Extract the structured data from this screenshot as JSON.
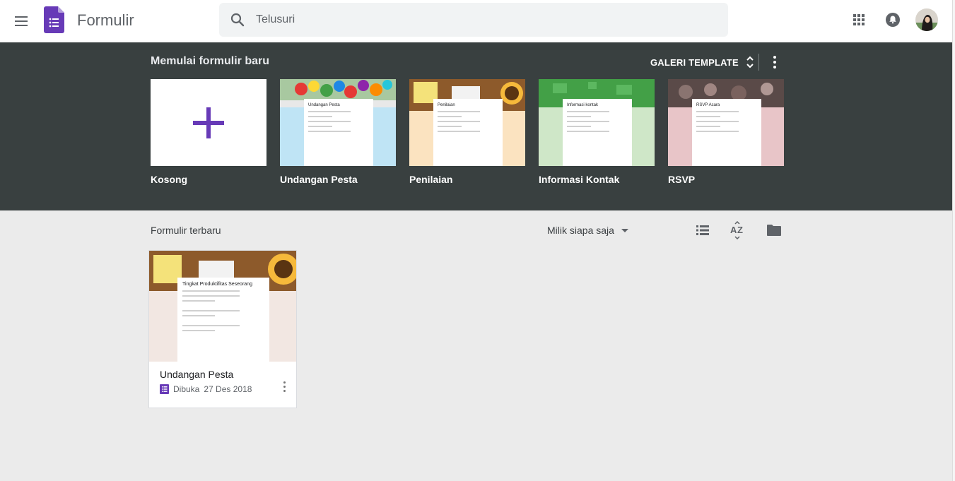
{
  "header": {
    "app_name": "Formulir",
    "search_placeholder": "Telusuri",
    "brand_color": "#673ab7"
  },
  "templates": {
    "section_title": "Memulai formulir baru",
    "gallery_label": "GALERI TEMPLATE",
    "items": [
      {
        "label": "Kosong"
      },
      {
        "label": "Undangan Pesta",
        "thumb_title": "Undangan Pesta",
        "bg": "#bfe4f5"
      },
      {
        "label": "Penilaian",
        "thumb_title": "Penilaian",
        "bg": "#fbe3c0"
      },
      {
        "label": "Informasi Kontak",
        "thumb_title": "Informasi kontak",
        "bg": "#cfe7c8"
      },
      {
        "label": "RSVP",
        "thumb_title": "RSVP Acara",
        "bg": "#e8c5c8"
      }
    ]
  },
  "recent": {
    "title": "Formulir terbaru",
    "owner_filter": "Milik siapa saja",
    "docs": [
      {
        "name": "Undangan Pesta",
        "opened_label": "Dibuka",
        "date": "27 Des 2018",
        "thumb_title": "Tingkat Produktifitas Seseorang"
      }
    ]
  }
}
